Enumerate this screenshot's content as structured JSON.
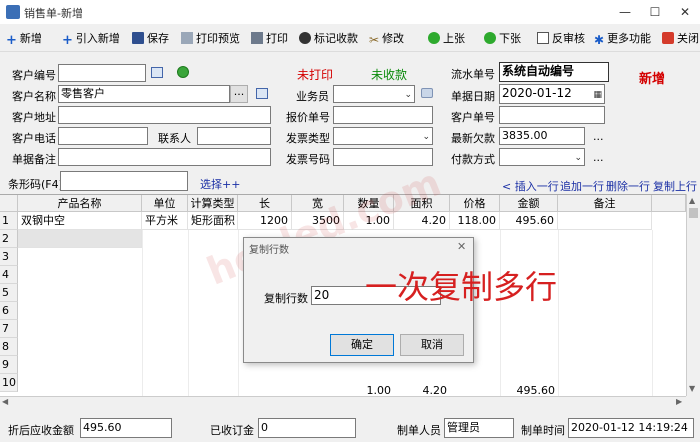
{
  "window": {
    "title": "销售单-新增",
    "minimize": "—",
    "maximize": "☐",
    "close": "✕"
  },
  "toolbar": {
    "new": "新增",
    "import_new": "引入新增",
    "save": "保存",
    "print_preview": "打印预览",
    "print": "打印",
    "mark_collect": "标记收款",
    "edit": "修改",
    "prev": "上张",
    "next": "下张",
    "unaudit": "反审核",
    "more": "更多功能",
    "close": "关闭"
  },
  "form": {
    "customer_code_label": "客户编号",
    "customer_code": "",
    "customer_name_label": "客户名称",
    "customer_name": "零售客户",
    "customer_addr_label": "客户地址",
    "customer_addr": "",
    "customer_phone_label": "客户电话",
    "customer_phone": "",
    "contact_label": "联系人",
    "contact": "",
    "remark_label": "单据备注",
    "remark": "",
    "print_status": "未打印",
    "collect_status": "未收款",
    "salesman_label": "业务员",
    "salesman": "",
    "quote_no_label": "报价单号",
    "quote_no": "",
    "invoice_type_label": "发票类型",
    "invoice_type": "",
    "invoice_no_label": "发票号码",
    "invoice_no": "",
    "serial_label": "流水单号",
    "serial": "系统自动编号",
    "doc_date_label": "单据日期",
    "doc_date": "2020-01-12",
    "customer_doc_label": "客户单号",
    "customer_doc": "",
    "latest_debt_label": "最新欠款",
    "latest_debt": "3835.00",
    "pay_method_label": "付款方式",
    "pay_method": "",
    "mode_badge": "新增",
    "ellipsis": "...",
    "dots": "..."
  },
  "barcode": {
    "label": "条形码(F4)",
    "value": "",
    "select_link": "选择++"
  },
  "row_actions": {
    "insert": "< 插入一行",
    "append": "追加一行",
    "delete": "删除一行",
    "copy": "复制上行"
  },
  "grid": {
    "headers": [
      "产品名称",
      "单位",
      "计算类型",
      "长",
      "宽",
      "数量",
      "面积",
      "价格",
      "金额",
      "备注"
    ],
    "rows": [
      {
        "no": "1",
        "name": "双钢中空",
        "unit": "平方米",
        "calc": "矩形面积",
        "len": "1200",
        "wid": "3500",
        "qty": "1.00",
        "area": "4.20",
        "price": "118.00",
        "amount": "495.60",
        "note": ""
      }
    ],
    "row_numbers": [
      "2",
      "3",
      "4",
      "5",
      "6",
      "7",
      "8",
      "9",
      "10"
    ],
    "totals": {
      "qty": "1.00",
      "area": "4.20",
      "amount": "495.60"
    }
  },
  "dialog": {
    "title": "复制行数",
    "close": "✕",
    "label": "复制行数",
    "value": "20",
    "ok": "确定",
    "cancel": "取消"
  },
  "annotation": "一次复制多行",
  "watermark": "heoled.com",
  "footer": {
    "discount_label": "折后应收金额",
    "discount_value": "495.60",
    "deposit_label": "已收订金",
    "deposit_value": "0",
    "creator_label": "制单人员",
    "creator_value": "管理员",
    "time_label": "制单时间",
    "time_value": "2020-01-12 14:19:24"
  },
  "colors": {
    "red": "#d40000",
    "green": "#0a8a0a",
    "blue": "#1a2fa5"
  }
}
